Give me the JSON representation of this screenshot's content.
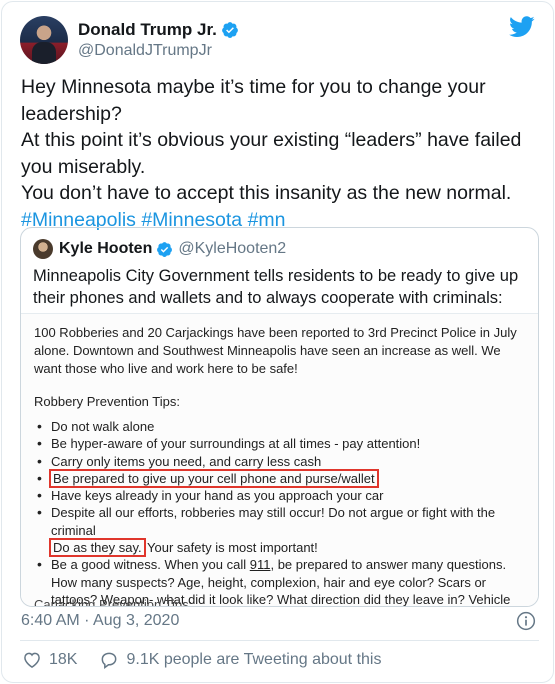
{
  "tweet": {
    "author": {
      "display_name": "Donald Trump Jr.",
      "handle": "@DonaldJTrumpJr"
    },
    "text": {
      "line1": "Hey Minnesota maybe it’s time for you to change your",
      "line2": "leadership?",
      "line3": "At this point it’s obvious your existing “leaders” have failed",
      "line4": "you miserably.",
      "line5": "You don’t have to accept this insanity as the new normal.",
      "hashtags": [
        "#Minneapolis",
        "#Minnesota",
        "#mn"
      ]
    },
    "timestamp": "6:40 AM · Aug 3, 2020",
    "likes": "18K",
    "conversation": "9.1K people are Tweeting about this"
  },
  "quote": {
    "display_name": "Kyle Hooten",
    "handle": "@KyleHooten2",
    "text": "Minneapolis City Government tells residents to be ready to give up their phones and wallets and to always cooperate with criminals:",
    "document": {
      "intro": "100 Robberies and 20 Carjackings have been reported to 3rd Precinct Police in July alone. Downtown and Southwest Minneapolis have seen an increase as well. We want those who live and work here to be safe!",
      "heading": "Robbery Prevention Tips:",
      "tips": {
        "t1": "Do not walk alone",
        "t2": "Be hyper-aware of your surroundings at all times - pay attention!",
        "t3": "Carry only items you need, and carry less cash",
        "t4": "Be prepared to give up your cell phone and purse/wallet",
        "t5": "Have keys already in your hand as you approach your car",
        "t6a": "Despite all our efforts, robberies may still occur! Do not argue or fight with the criminal",
        "t6b": "Do as they say.",
        "t6c": " Your safety is most important!",
        "t7a": "Be a good witness. When you call ",
        "t7b": "911",
        "t7c": ", be prepared to answer many questions. How many suspects? Age, height, complexion, hair and eye color? Scars or tattoos? Weapon- what did it look like? What direction did they leave in? Vehicle description?"
      },
      "cutoff_heading": "Carjacking Prevention Tips:"
    }
  },
  "colors": {
    "brand_blue": "#1da1f2",
    "hashtag_blue": "#1b95e0",
    "highlight_red": "#e0362c",
    "muted_gray": "#657786"
  },
  "icons": {
    "verified": "verified-badge-icon",
    "twitter": "twitter-bird-icon",
    "info": "info-icon",
    "like": "heart-icon",
    "reply": "speech-bubble-icon"
  }
}
